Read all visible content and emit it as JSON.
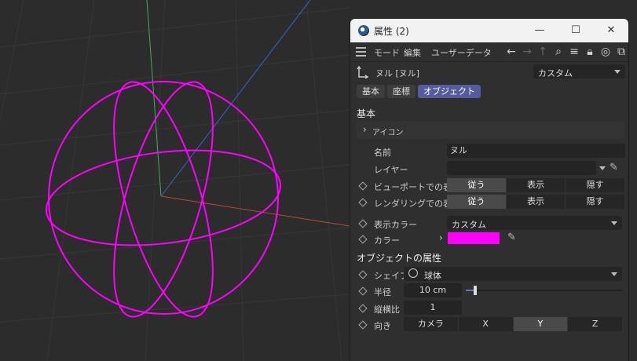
{
  "window": {
    "title": "属性 (2)",
    "min": "—",
    "max": "☐",
    "close": "✕"
  },
  "menu": {
    "mode": "モード",
    "edit": "編集",
    "userdata": "ユーザーデータ"
  },
  "object": {
    "name": "ヌル [ヌル]",
    "preset": "カスタム"
  },
  "tabs": [
    {
      "label": "基本"
    },
    {
      "label": "座標"
    },
    {
      "label": "オブジェクト"
    }
  ],
  "basic": {
    "title": "基本",
    "icon_label": "アイコン",
    "name_label": "名前",
    "name_value": "ヌル",
    "layer_label": "レイヤー",
    "viewport_label": "ビューポートでの表示",
    "render_label": "レンダリングでの表示",
    "vis_options": [
      "従う",
      "表示",
      "隠す"
    ],
    "displaycolor_label": "表示カラー",
    "displaycolor_value": "カスタム",
    "color_label": "カラー",
    "color_value": "#ff00ff"
  },
  "objprops": {
    "title": "オブジェクトの属性",
    "shape_label": "シェイプ",
    "shape_value": "球体",
    "radius_label": "半径",
    "radius_value": "10 cm",
    "radius_slider_fraction": 0.06,
    "aspect_label": "縦横比",
    "aspect_value": "1",
    "orient_label": "向き",
    "orient_options": [
      "カメラ",
      "X",
      "Y",
      "Z"
    ],
    "orient_selected": "Y"
  },
  "colors": {
    "accent": "#545c9e",
    "null_color": "#ff00ff",
    "axis_x": "#c0463a",
    "axis_y": "#3fae5b",
    "axis_z": "#3a64c8"
  }
}
